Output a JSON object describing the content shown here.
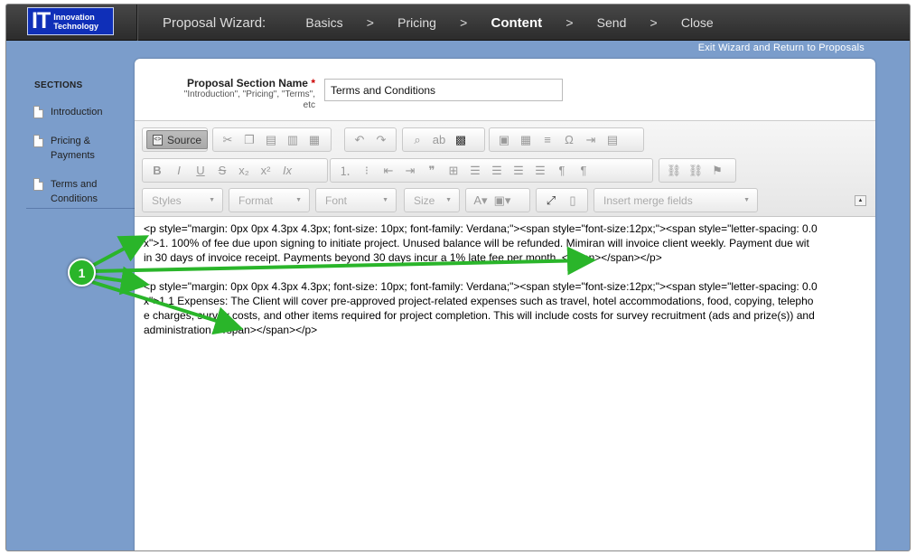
{
  "logo": {
    "it": "IT",
    "line1": "Innovation",
    "line2": "Technology"
  },
  "wizard": {
    "title": "Proposal Wizard:",
    "steps": [
      "Basics",
      "Pricing",
      "Content",
      "Send",
      "Close"
    ],
    "separator": ">",
    "active_step": "Content"
  },
  "exit_link": "Exit Wizard and Return to Proposals",
  "sidebar": {
    "heading": "SECTIONS",
    "items": [
      {
        "label": "Introduction"
      },
      {
        "label": "Pricing & Payments"
      },
      {
        "label": "Terms and Conditions"
      }
    ]
  },
  "form": {
    "label": "Proposal Section Name",
    "required_mark": "*",
    "hint": "\"Introduction\", \"Pricing\", \"Terms\", etc",
    "value": "Terms and Conditions"
  },
  "toolbar": {
    "source_label": "Source",
    "styles": "Styles",
    "format": "Format",
    "font": "Font",
    "size": "Size",
    "merge_fields": "Insert merge fields"
  },
  "content": {
    "lines": [
      "<p style=\"margin: 0px 0px 4.3px 4.3px; font-size: 10px; font-family: Verdana;\"><span style=\"font-size:12px;\"><span style=\"letter-spacing: 0.0",
      "x\">1. 100% of fee due upon signing to initiate project.  Unused balance will be refunded.  Mimiran will invoice client weekly.  Payment due wit",
      "in 30 days of invoice receipt. Payments beyond 30 days incur a 1% late fee per month. </span></span></p>",
      "",
      "<p style=\"margin: 0px 0px 4.3px 4.3px; font-size: 10px; font-family: Verdana;\"><span style=\"font-size:12px;\"><span style=\"letter-spacing: 0.0",
      "x\">1.1 Expenses:  The Client will cover pre-approved project-related expenses such as travel, hotel accommodations, food, copying, telepho",
      "e charges, survey costs, and other items required for project completion.  This will include costs for survey recruitment (ads and prize(s)) and",
      "administration. </span></span></p>"
    ]
  },
  "callout": {
    "number": "1",
    "color": "#2ab52a"
  },
  "colors": {
    "background": "#7b9dcb",
    "topbar": "#333333",
    "logo": "#0f2fb8",
    "accent": "#2ab52a"
  }
}
